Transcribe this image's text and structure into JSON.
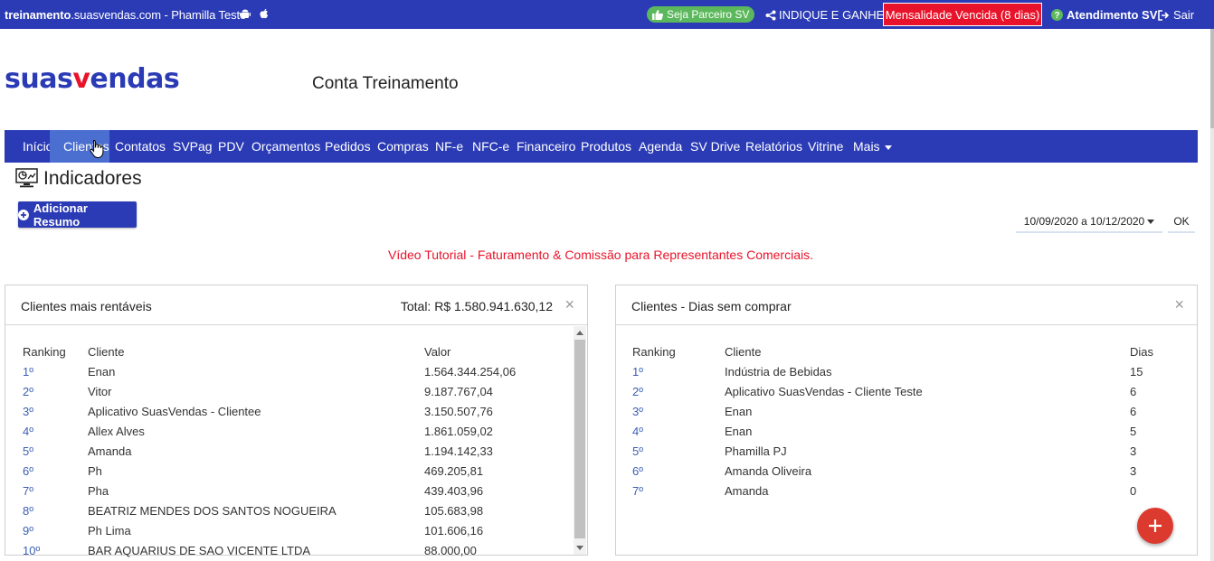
{
  "topbar": {
    "site_bold": "treinamento",
    "site_rest": ".suasvendas.com - Phamilla Teste",
    "icons": [
      "android-icon",
      "apple-icon"
    ],
    "partner_label": "Seja Parceiro SV",
    "indique_label": "INDIQUE E GANHE",
    "mensalidade_label": "Mensalidade Vencida (8 dias)",
    "atendimento_label": "Atendimento SV",
    "sair_label": "Sair",
    "colors": {
      "bar": "#2b3bb5",
      "partner": "#5cb85c",
      "alert": "#e8132a"
    }
  },
  "brand": {
    "logo_part1": "suas",
    "logo_part2": "v",
    "logo_part3": "endas",
    "account_title": "Conta Treinamento"
  },
  "nav": {
    "items": [
      "Início",
      "Clientes",
      "Contatos",
      "SVPag",
      "PDV",
      "Orçamentos",
      "Pedidos",
      "Compras",
      "NF-e",
      "NFC-e",
      "Financeiro",
      "Produtos",
      "Agenda",
      "SV Drive",
      "Relatórios",
      "Vitrine",
      "Mais"
    ],
    "active": "Clientes"
  },
  "page": {
    "title": "Indicadores",
    "add_button": "Adicionar Resumo",
    "date_range": "10/09/2020 a 10/12/2020",
    "ok_label": "OK",
    "tutorial": "Vídeo Tutorial - Faturamento & Comissão para Representantes Comerciais."
  },
  "panel_left": {
    "title": "Clientes mais rentáveis",
    "total": "Total: R$ 1.580.941.630,12",
    "headers": [
      "Ranking",
      "Cliente",
      "Valor"
    ],
    "rows": [
      [
        "1º",
        "Enan",
        "1.564.344.254,06"
      ],
      [
        "2º",
        "Vitor",
        "9.187.767,04"
      ],
      [
        "3º",
        "Aplicativo SuasVendas - Clientee",
        "3.150.507,76"
      ],
      [
        "4º",
        "Allex Alves",
        "1.861.059,02"
      ],
      [
        "5º",
        "Amanda",
        "1.194.142,33"
      ],
      [
        "6º",
        "Ph",
        "469.205,81"
      ],
      [
        "7º",
        "Pha",
        "439.403,96"
      ],
      [
        "8º",
        "BEATRIZ MENDES DOS SANTOS NOGUEIRA",
        "105.683,98"
      ],
      [
        "9º",
        "Ph Lima",
        "101.606,16"
      ],
      [
        "10º",
        "BAR AQUARIUS DE SAO VICENTE LTDA",
        "88.000,00"
      ]
    ]
  },
  "panel_right": {
    "title": "Clientes - Dias sem comprar",
    "headers": [
      "Ranking",
      "Cliente",
      "Dias"
    ],
    "rows": [
      [
        "1º",
        "Indústria de Bebidas",
        "15"
      ],
      [
        "2º",
        "Aplicativo SuasVendas - Cliente Teste",
        "6"
      ],
      [
        "3º",
        "Enan",
        "6"
      ],
      [
        "4º",
        "Enan",
        "5"
      ],
      [
        "5º",
        "Phamilla PJ",
        "3"
      ],
      [
        "6º",
        "Amanda Oliveira",
        "3"
      ],
      [
        "7º",
        "Amanda",
        "0"
      ]
    ]
  },
  "close_glyph": "×",
  "fab_icon": "plus-icon"
}
